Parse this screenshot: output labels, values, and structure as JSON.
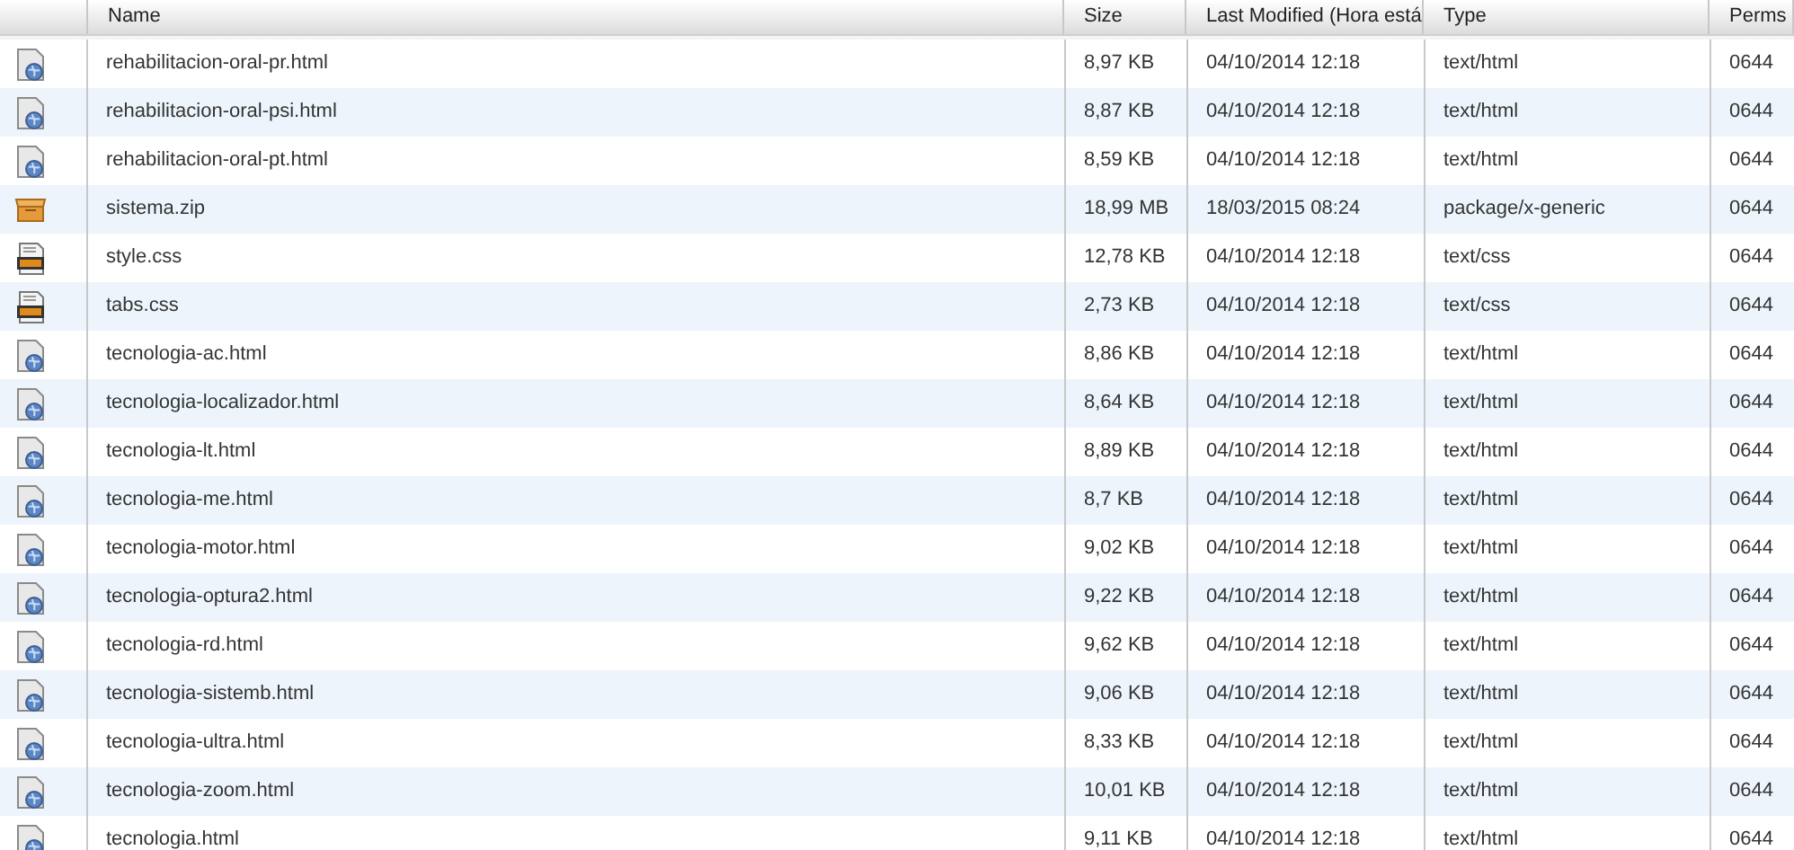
{
  "table": {
    "columns": [
      "Name",
      "Size",
      "Last Modified (Hora está",
      "Type",
      "Perms"
    ],
    "rows": [
      {
        "kind": "html",
        "name": "rehabilitacion-oral-pr.html",
        "size": "8,97 KB",
        "modified": "04/10/2014 12:18",
        "type": "text/html",
        "perms": "0644"
      },
      {
        "kind": "html",
        "name": "rehabilitacion-oral-psi.html",
        "size": "8,87 KB",
        "modified": "04/10/2014 12:18",
        "type": "text/html",
        "perms": "0644"
      },
      {
        "kind": "html",
        "name": "rehabilitacion-oral-pt.html",
        "size": "8,59 KB",
        "modified": "04/10/2014 12:18",
        "type": "text/html",
        "perms": "0644"
      },
      {
        "kind": "zip",
        "name": "sistema.zip",
        "size": "18,99 MB",
        "modified": "18/03/2015 08:24",
        "type": "package/x-generic",
        "perms": "0644"
      },
      {
        "kind": "css",
        "name": "style.css",
        "size": "12,78 KB",
        "modified": "04/10/2014 12:18",
        "type": "text/css",
        "perms": "0644"
      },
      {
        "kind": "css",
        "name": "tabs.css",
        "size": "2,73 KB",
        "modified": "04/10/2014 12:18",
        "type": "text/css",
        "perms": "0644"
      },
      {
        "kind": "html",
        "name": "tecnologia-ac.html",
        "size": "8,86 KB",
        "modified": "04/10/2014 12:18",
        "type": "text/html",
        "perms": "0644"
      },
      {
        "kind": "html",
        "name": "tecnologia-localizador.html",
        "size": "8,64 KB",
        "modified": "04/10/2014 12:18",
        "type": "text/html",
        "perms": "0644"
      },
      {
        "kind": "html",
        "name": "tecnologia-lt.html",
        "size": "8,89 KB",
        "modified": "04/10/2014 12:18",
        "type": "text/html",
        "perms": "0644"
      },
      {
        "kind": "html",
        "name": "tecnologia-me.html",
        "size": "8,7 KB",
        "modified": "04/10/2014 12:18",
        "type": "text/html",
        "perms": "0644"
      },
      {
        "kind": "html",
        "name": "tecnologia-motor.html",
        "size": "9,02 KB",
        "modified": "04/10/2014 12:18",
        "type": "text/html",
        "perms": "0644"
      },
      {
        "kind": "html",
        "name": "tecnologia-optura2.html",
        "size": "9,22 KB",
        "modified": "04/10/2014 12:18",
        "type": "text/html",
        "perms": "0644"
      },
      {
        "kind": "html",
        "name": "tecnologia-rd.html",
        "size": "9,62 KB",
        "modified": "04/10/2014 12:18",
        "type": "text/html",
        "perms": "0644"
      },
      {
        "kind": "html",
        "name": "tecnologia-sistemb.html",
        "size": "9,06 KB",
        "modified": "04/10/2014 12:18",
        "type": "text/html",
        "perms": "0644"
      },
      {
        "kind": "html",
        "name": "tecnologia-ultra.html",
        "size": "8,33 KB",
        "modified": "04/10/2014 12:18",
        "type": "text/html",
        "perms": "0644"
      },
      {
        "kind": "html",
        "name": "tecnologia-zoom.html",
        "size": "10,01 KB",
        "modified": "04/10/2014 12:18",
        "type": "text/html",
        "perms": "0644"
      },
      {
        "kind": "html",
        "name": "tecnologia.html",
        "size": "9,11 KB",
        "modified": "04/10/2014 12:18",
        "type": "text/html",
        "perms": "0644"
      }
    ]
  }
}
